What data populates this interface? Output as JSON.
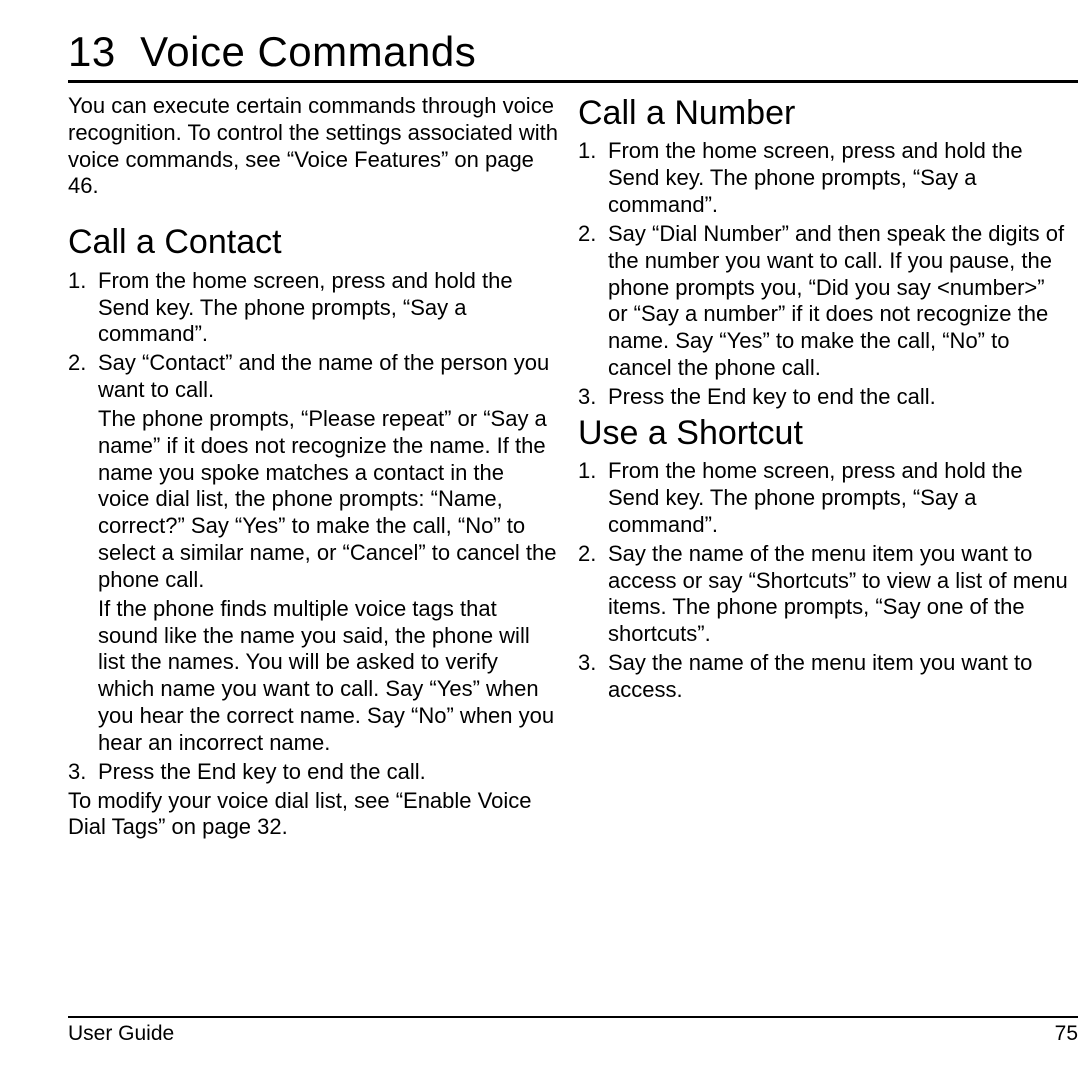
{
  "chapter": {
    "number": "13",
    "title": "Voice Commands"
  },
  "intro": "You can execute certain commands through voice recognition. To control the settings associated with voice commands, see “Voice Features” on page 46.",
  "left": {
    "heading1": "Call a Contact",
    "steps1": {
      "s1": "From the home screen, press and hold the Send key. The phone prompts, “Say a command”.",
      "s2_main": "Say “Contact” and the name of the person you want to call.",
      "s2_p1": "The phone prompts, “Please repeat” or “Say a name” if it does not recognize the name. If the name you spoke matches a contact in the voice dial list, the phone prompts: “Name, correct?” Say “Yes” to make the call, “No” to select a similar name, or “Cancel” to cancel the phone call.",
      "s2_p2": "If the phone finds multiple voice tags that sound like the name you said, the phone will list the names. You will be asked to verify which name you want to call. Say “Yes” when you hear the correct name. Say “No” when you hear an incorrect name.",
      "s3": "Press the End key to end the call."
    },
    "after1": "To modify your voice dial list, see “Enable Voice Dial Tags” on page 32."
  },
  "right": {
    "heading1": "Call a Number",
    "steps1": {
      "s1": "From the home screen, press and hold the Send key. The phone prompts, “Say a command”.",
      "s2": "Say “Dial Number” and then speak the digits of the number you want to call. If you pause, the phone prompts you, “Did you say <number>” or “Say a number” if it does not recognize the name. Say “Yes” to make the call, “No” to cancel the phone call.",
      "s3": "Press the End key to end the call."
    },
    "heading2": "Use a Shortcut",
    "steps2": {
      "s1": "From the home screen, press and hold the Send key. The phone prompts, “Say a command”.",
      "s2": "Say the name of the menu item you want to access or say “Shortcuts” to view a list of menu items. The phone prompts, “Say one of the shortcuts”.",
      "s3": "Say the name of the menu item you want to access."
    }
  },
  "footer": {
    "left": "User Guide",
    "right": "75"
  }
}
